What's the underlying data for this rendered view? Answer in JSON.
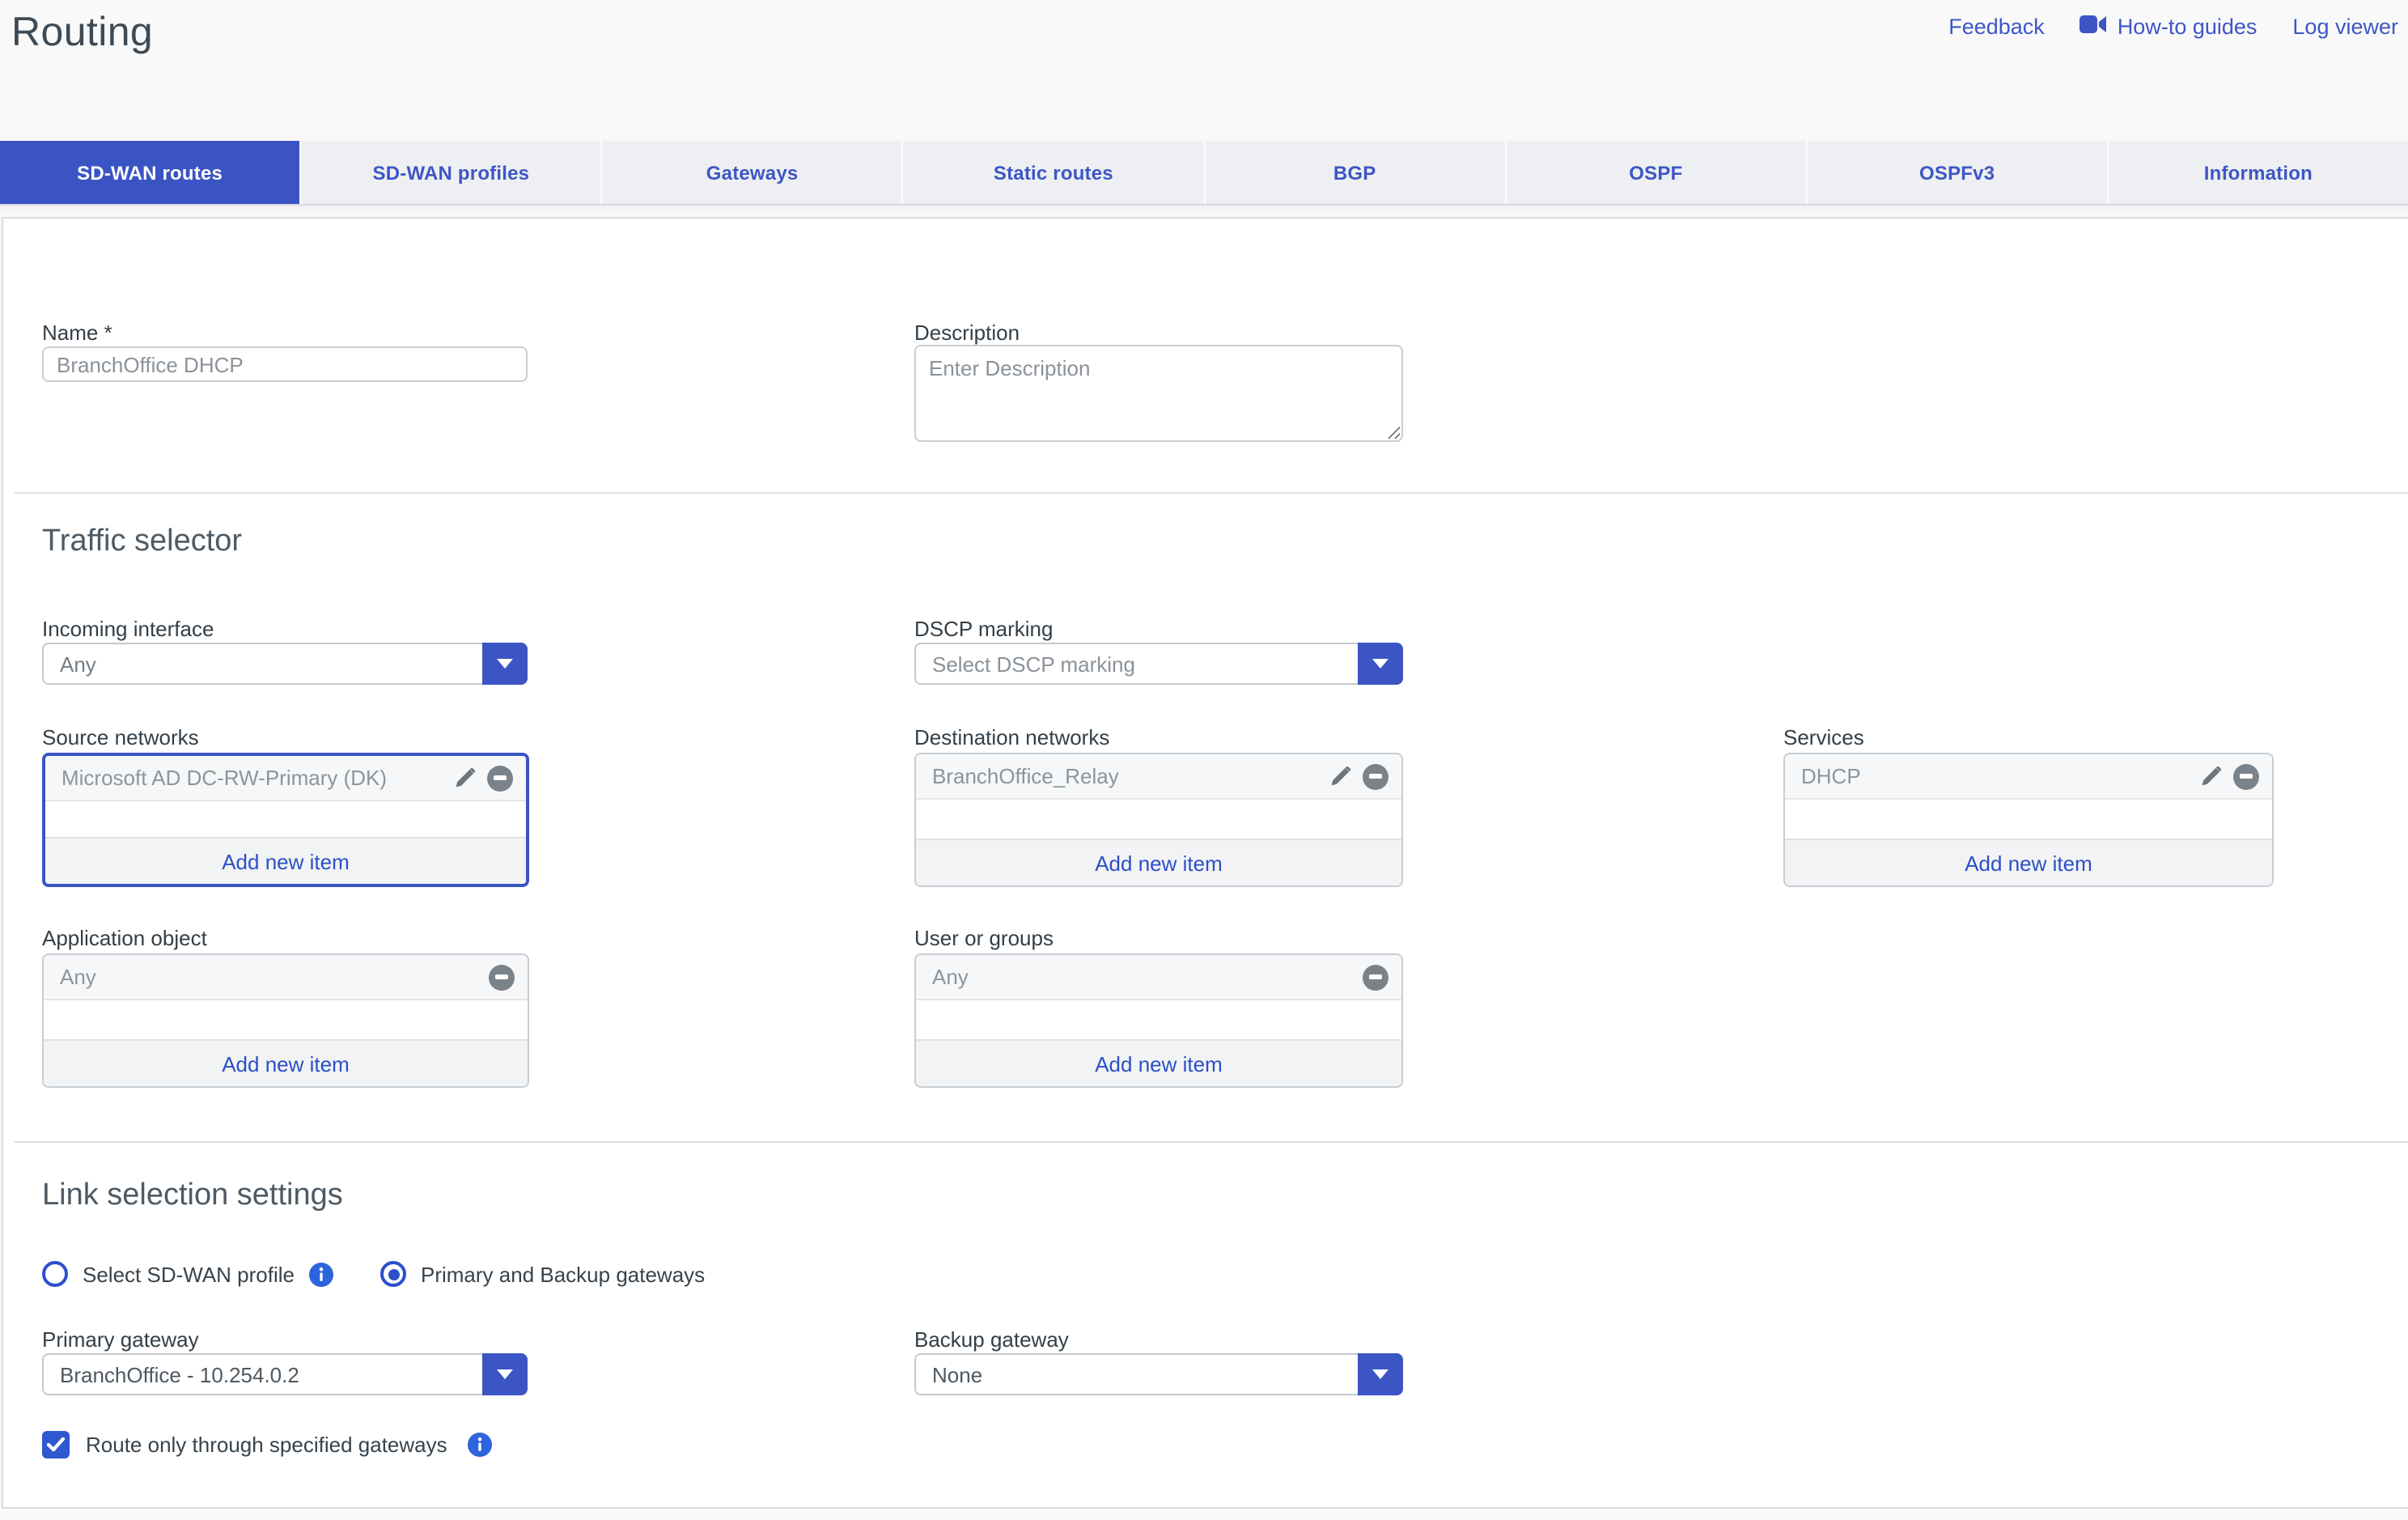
{
  "header": {
    "title": "Routing",
    "links": [
      {
        "label": "Feedback"
      },
      {
        "label": "How-to guides",
        "icon": "video-camera-icon"
      },
      {
        "label": "Log viewer"
      }
    ]
  },
  "tabs": [
    {
      "label": "SD-WAN routes",
      "active": true
    },
    {
      "label": "SD-WAN profiles",
      "active": false
    },
    {
      "label": "Gateways",
      "active": false
    },
    {
      "label": "Static routes",
      "active": false
    },
    {
      "label": "BGP",
      "active": false
    },
    {
      "label": "OSPF",
      "active": false
    },
    {
      "label": "OSPFv3",
      "active": false
    },
    {
      "label": "Information",
      "active": false
    }
  ],
  "form": {
    "name": {
      "label": "Name *",
      "value": "BranchOffice DHCP"
    },
    "description": {
      "label": "Description",
      "placeholder": "Enter Description"
    },
    "traffic_selector": {
      "heading": "Traffic selector",
      "incoming_interface": {
        "label": "Incoming interface",
        "value": "Any"
      },
      "dscp_marking": {
        "label": "DSCP marking",
        "placeholder": "Select DSCP marking"
      },
      "source_networks": {
        "label": "Source networks",
        "items": [
          "Microsoft AD DC-RW-Primary (DK)"
        ],
        "add_label": "Add new item"
      },
      "destination_networks": {
        "label": "Destination networks",
        "items": [
          "BranchOffice_Relay"
        ],
        "add_label": "Add new item"
      },
      "services": {
        "label": "Services",
        "items": [
          "DHCP"
        ],
        "add_label": "Add new item"
      },
      "application_object": {
        "label": "Application object",
        "items": [
          "Any"
        ],
        "add_label": "Add new item"
      },
      "user_or_groups": {
        "label": "User or groups",
        "items": [
          "Any"
        ],
        "add_label": "Add new item"
      }
    },
    "link_selection": {
      "heading": "Link selection settings",
      "radio_profile_label": "Select SD-WAN profile",
      "radio_gateways_label": "Primary and Backup gateways",
      "selected_radio": "Primary and Backup gateways",
      "primary_gateway": {
        "label": "Primary gateway",
        "value": "BranchOffice - 10.254.0.2"
      },
      "backup_gateway": {
        "label": "Backup gateway",
        "value": "None"
      },
      "route_only_checkbox": {
        "label": "Route only through specified gateways",
        "checked": true
      }
    }
  },
  "colors": {
    "accent": "#3B55C4",
    "link": "#3D56C6",
    "info": "#2D63DB",
    "tab_inactive_bg": "#EEEFF2",
    "card_border": "#D9DCDF"
  }
}
